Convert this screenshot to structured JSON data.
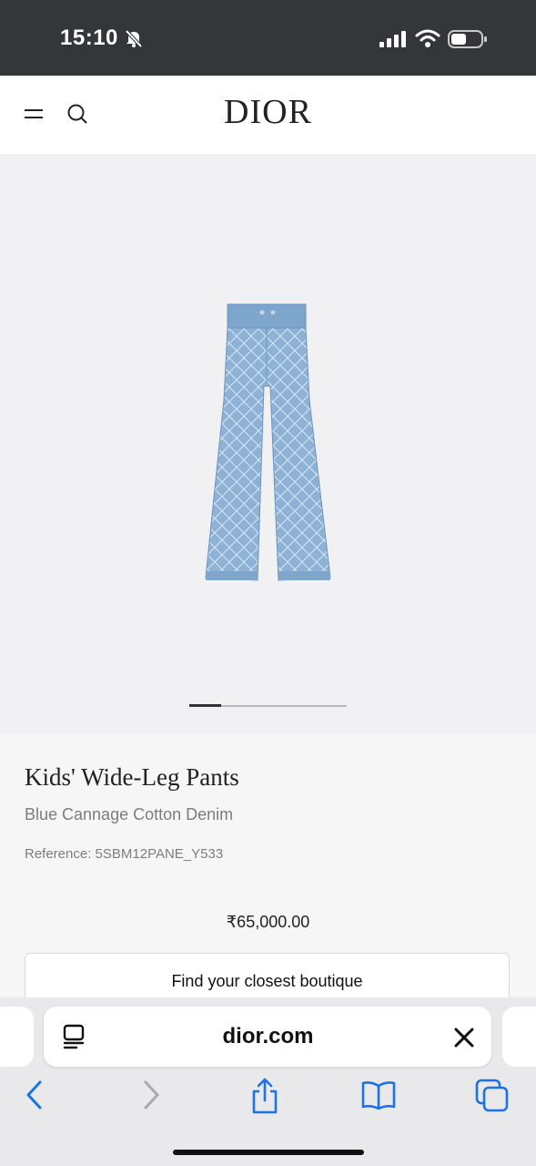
{
  "status_bar": {
    "time": "15:10"
  },
  "header": {
    "logo": "DIOR"
  },
  "gallery": {
    "current_index": 1,
    "total": 5
  },
  "product": {
    "title": "Kids' Wide-Leg Pants",
    "subtitle": "Blue Cannage Cotton Denim",
    "reference": "Reference: 5SBM12PANE_Y533",
    "price": "₹65,000.00",
    "boutique_button": "Find your closest boutique"
  },
  "browser": {
    "address": "dior.com"
  },
  "icons": {
    "status": [
      "bell-slash-icon",
      "signal-icon",
      "wifi-icon",
      "battery-icon"
    ],
    "header": [
      "menu-icon",
      "search-icon"
    ],
    "browser": [
      "reader-icon",
      "close-icon",
      "back-icon",
      "forward-icon",
      "share-icon",
      "bookmarks-icon",
      "tabs-icon"
    ]
  },
  "colors": {
    "status_bar_bg": "#34373a",
    "accent_blue": "#1a73e8",
    "denim": "#8fb3d6"
  }
}
